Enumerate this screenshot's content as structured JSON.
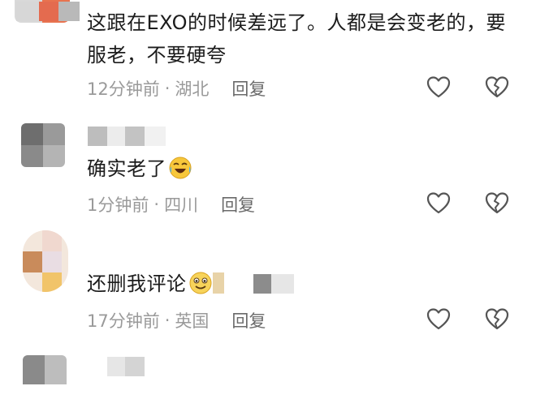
{
  "comments": [
    {
      "text": "这跟在EXO的时候差远了。人都是会变老的，要服老，不要硬夸",
      "time": "12分钟前",
      "separator": "·",
      "location": "湖北",
      "reply_label": "回复",
      "like_icon": "heart-outline-icon",
      "dislike_icon": "broken-heart-icon"
    },
    {
      "text": "确实老了",
      "emoji": "laughing-crying-emoji",
      "time": "1分钟前",
      "separator": "·",
      "location": "四川",
      "reply_label": "回复",
      "like_icon": "heart-outline-icon",
      "dislike_icon": "broken-heart-icon"
    },
    {
      "text": "还删我评论",
      "emoji": "smiling-emoji",
      "time": "17分钟前",
      "separator": "·",
      "location": "英国",
      "reply_label": "回复",
      "like_icon": "heart-outline-icon",
      "dislike_icon": "broken-heart-icon"
    }
  ],
  "colors": {
    "text": "#1c1c1c",
    "meta": "#9a9a9a",
    "reply": "#6a6a6a",
    "icon_stroke": "#555555"
  }
}
